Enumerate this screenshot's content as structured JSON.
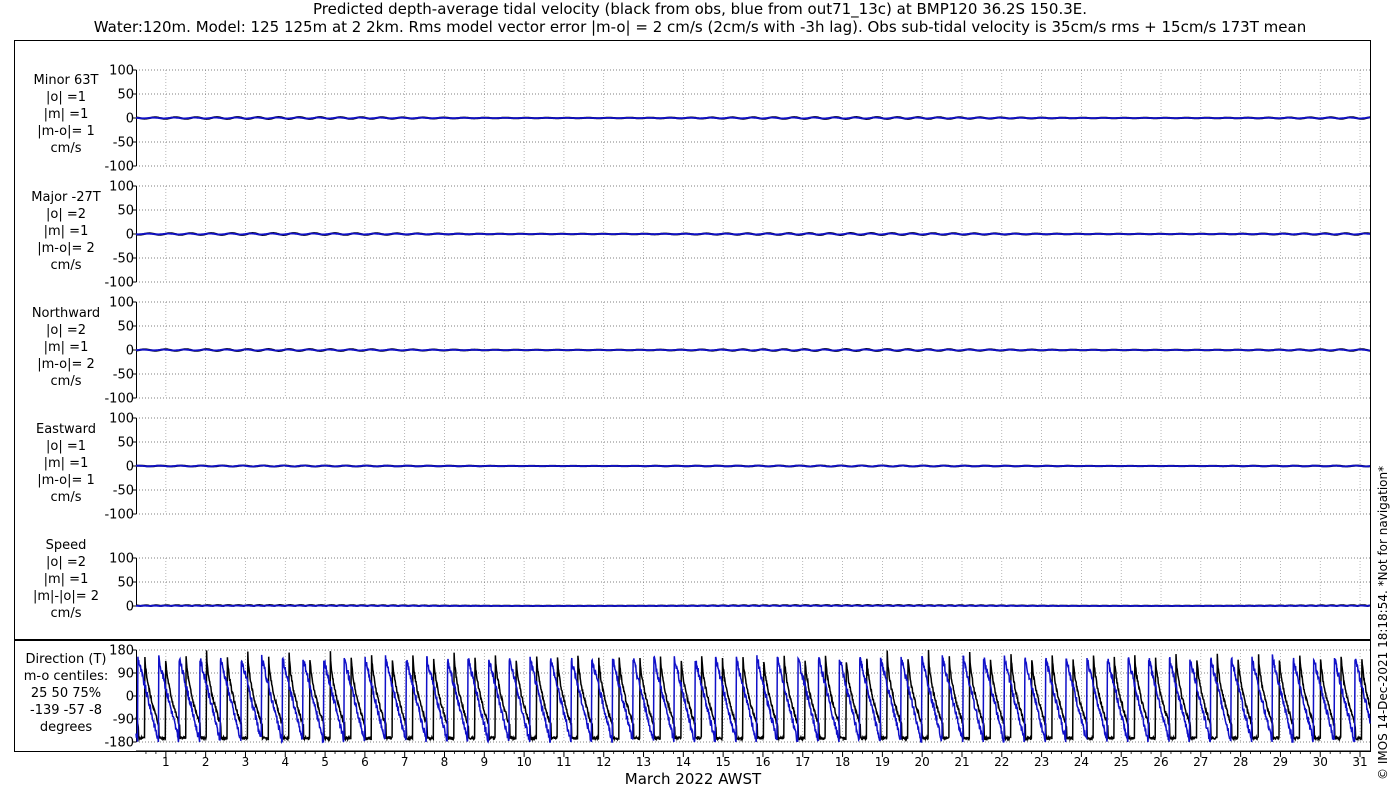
{
  "title_line1": "Predicted depth-average tidal velocity (black from obs, blue from out71_13c) at BMP120 36.2S 150.3E.",
  "title_line2": "Water:120m. Model: 125 125m at 2 2km. Rms model vector error |m-o| = 2 cm/s (2cm/s with -3h lag). Obs sub-tidal velocity is 35cm/s rms + 15cm/s 173T mean",
  "copyright": "© IMOS 14-Dec-2021 18:18:54. *Not for navigation*",
  "xlabel": "March 2022 AWST",
  "x_ticks": [
    "1",
    "2",
    "3",
    "4",
    "5",
    "6",
    "7",
    "8",
    "9",
    "10",
    "11",
    "12",
    "13",
    "14",
    "15",
    "16",
    "17",
    "18",
    "19",
    "20",
    "21",
    "22",
    "23",
    "24",
    "25",
    "26",
    "27",
    "28",
    "29",
    "30",
    "31"
  ],
  "chart_data": {
    "type": "line",
    "x_range_days": [
      0.25,
      31.25
    ],
    "series_legend": {
      "obs": {
        "color": "#000000"
      },
      "model": {
        "color": "#1010c8"
      }
    },
    "panels": [
      {
        "name": "minor",
        "label_lines": [
          "Minor 63T",
          "|o| =1",
          "|m| =1",
          "|m-o|= 1",
          "cm/s"
        ],
        "ylim": [
          -100,
          100
        ],
        "yticks": [
          "100",
          "50",
          "0",
          "-50",
          "-100"
        ],
        "obs_amp": 2,
        "model_amp": 1
      },
      {
        "name": "major",
        "label_lines": [
          "Major -27T",
          "|o| =2",
          "|m| =1",
          "|m-o|= 2",
          "cm/s"
        ],
        "ylim": [
          -100,
          100
        ],
        "yticks": [
          "100",
          "50",
          "0",
          "-50",
          "-100"
        ],
        "obs_amp": 2,
        "model_amp": 1
      },
      {
        "name": "northward",
        "label_lines": [
          "Northward",
          "|o| =2",
          "|m| =1",
          "|m-o|= 2",
          "cm/s"
        ],
        "ylim": [
          -100,
          100
        ],
        "yticks": [
          "100",
          "50",
          "0",
          "-50",
          "-100"
        ],
        "obs_amp": 2,
        "model_amp": 1
      },
      {
        "name": "eastward",
        "label_lines": [
          "Eastward",
          "|o| =1",
          "|m| =1",
          "|m-o|= 1",
          "cm/s"
        ],
        "ylim": [
          -100,
          100
        ],
        "yticks": [
          "100",
          "50",
          "0",
          "-50",
          "-100"
        ],
        "obs_amp": 1,
        "model_amp": 1
      },
      {
        "name": "speed",
        "label_lines": [
          "Speed",
          "|o| =2",
          "|m| =1",
          "|m|-|o|= 2",
          "cm/s"
        ],
        "ylim": [
          0,
          100
        ],
        "yticks": [
          "100",
          "50",
          "0"
        ],
        "obs_amp": 2,
        "model_amp": 1
      },
      {
        "name": "direction",
        "label_lines": [
          "Direction (T)",
          "m-o centiles:",
          "25  50  75%",
          "-139  -57   -8",
          "degrees"
        ],
        "ylim": [
          -180,
          180
        ],
        "yticks": [
          "180",
          "90",
          "0",
          "-90",
          "-180"
        ]
      }
    ]
  }
}
